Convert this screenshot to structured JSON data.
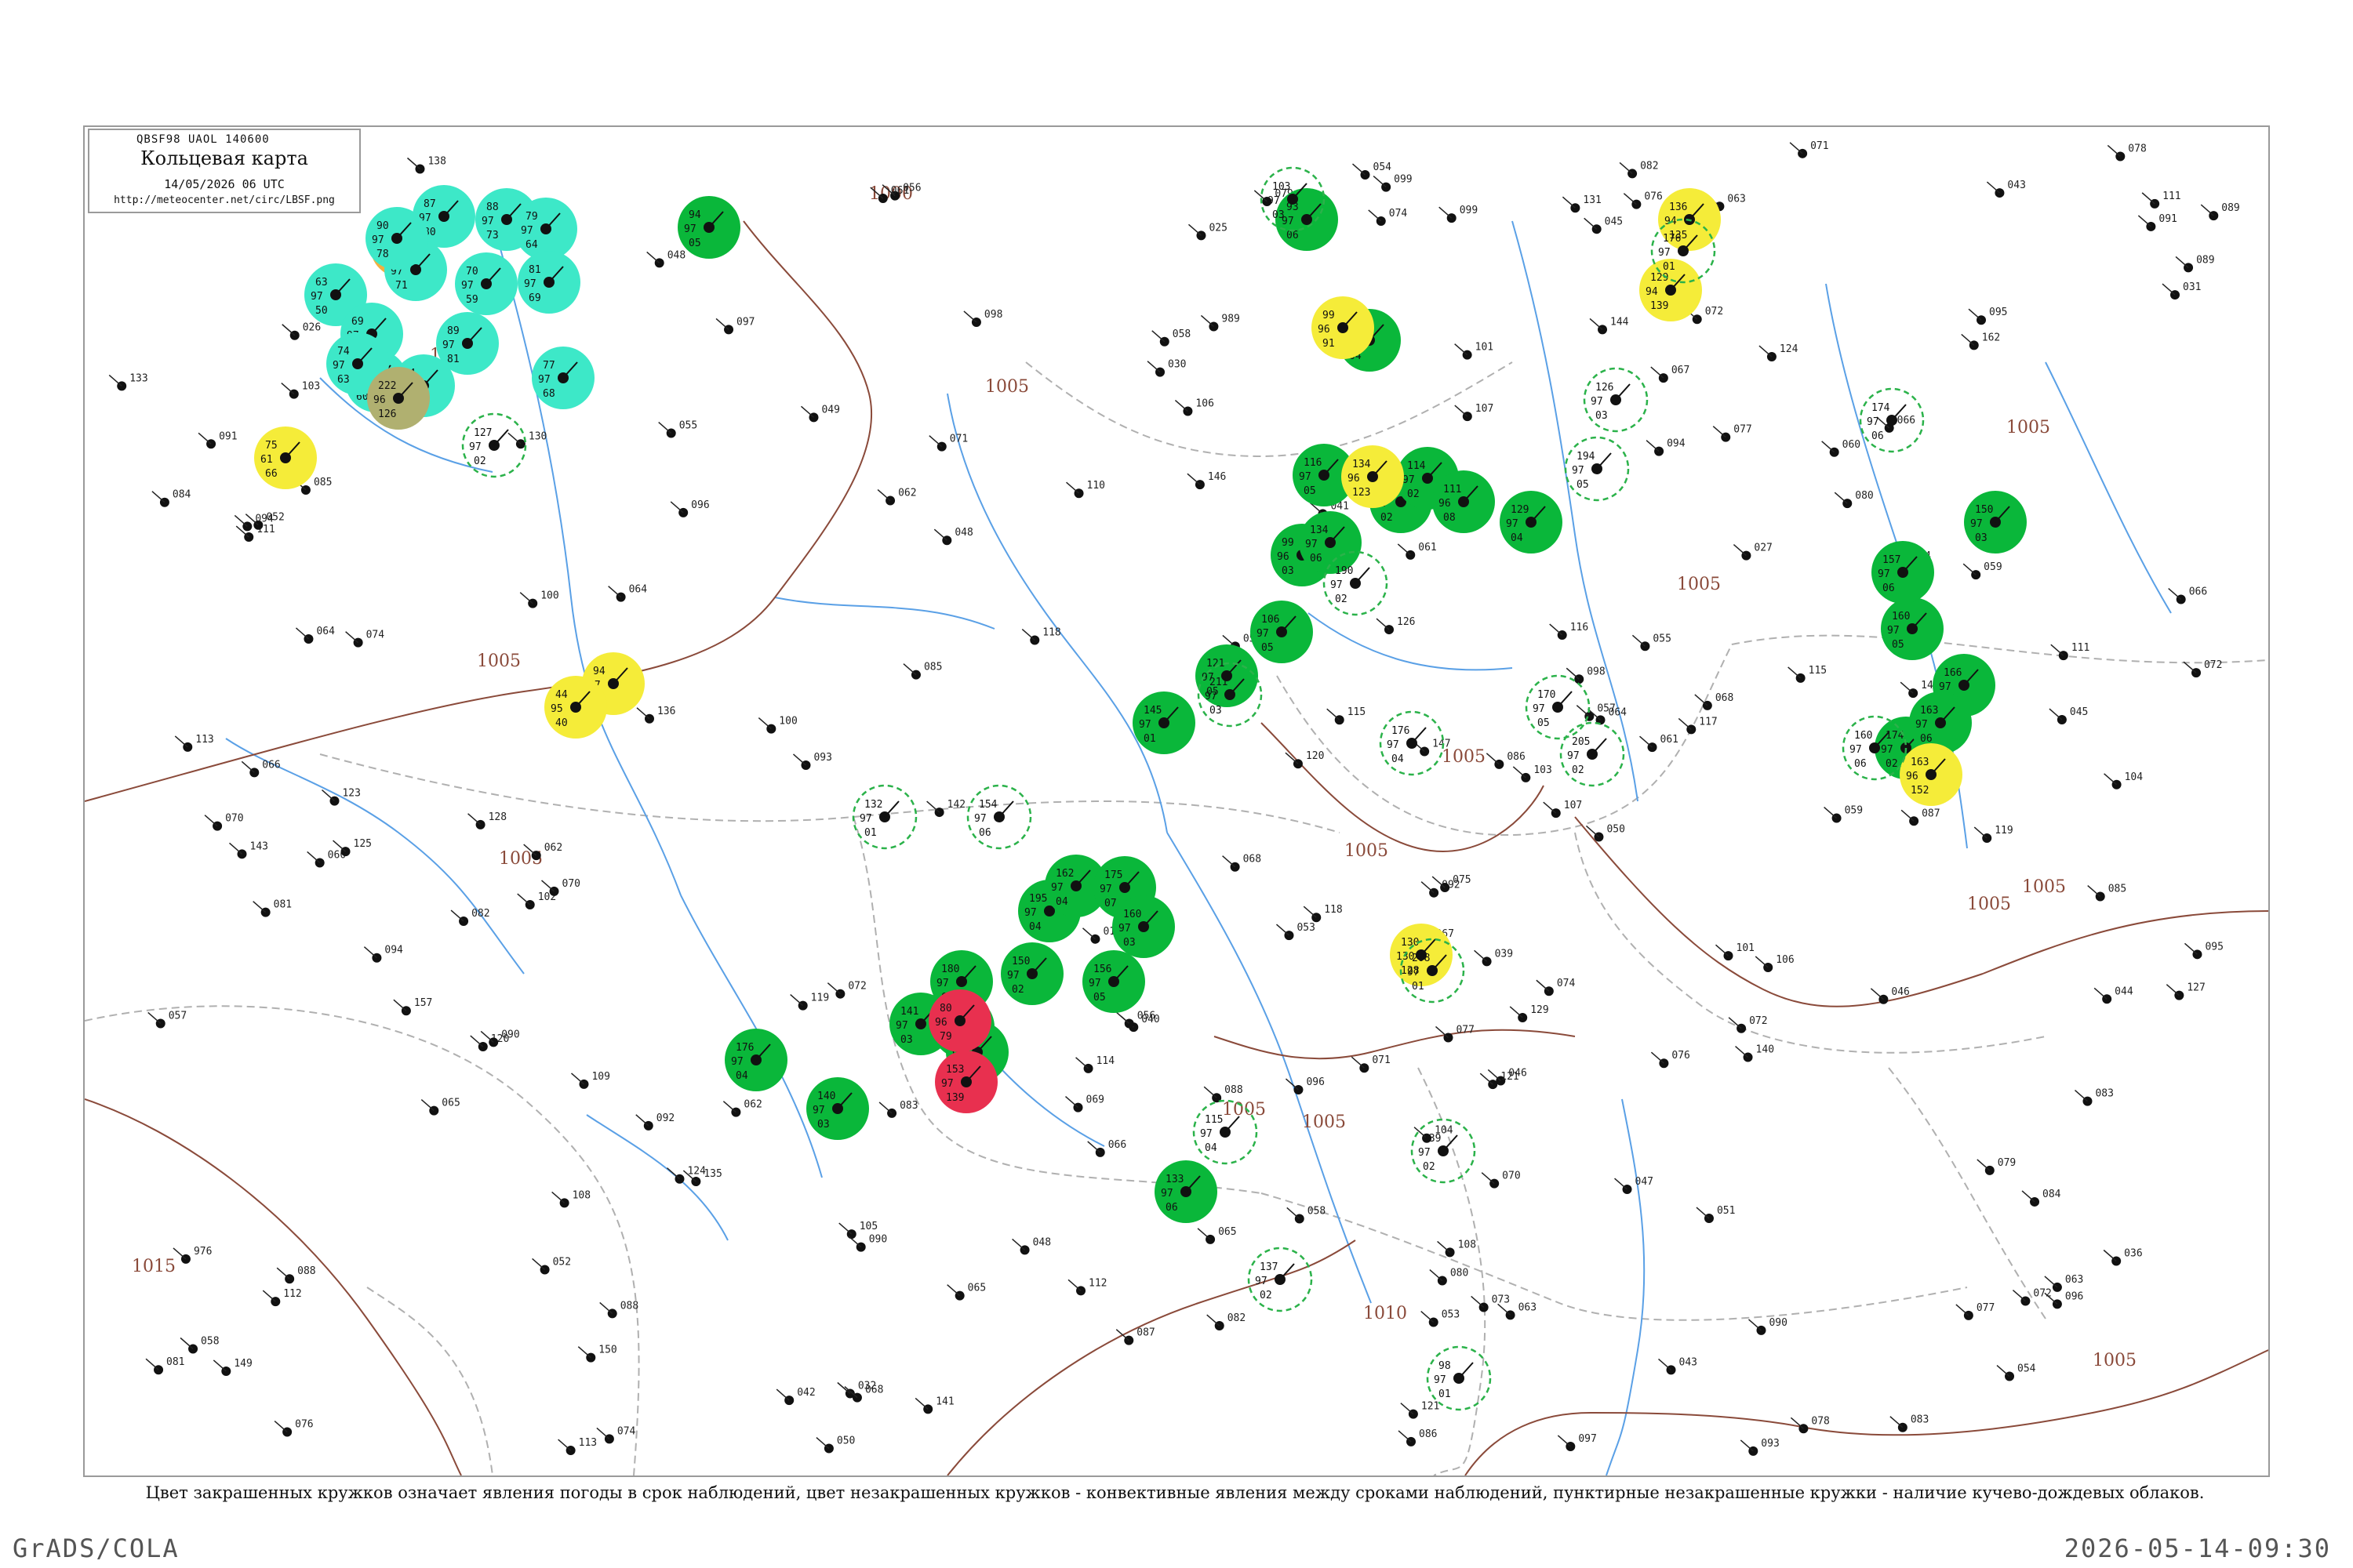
{
  "header": {
    "code": "QBSF98  UAOL  140600",
    "title": "Кольцевая карта",
    "time": "14/05/2026 06 UTC",
    "url": "http://meteocenter.net/circ/LBSF.png"
  },
  "footer": {
    "note": "Цвет закрашенных кружков означает явления погоды в срок наблюдений, цвет незакрашенных кружков - конвективные явления между сроками наблюдений, пунктирные незакрашенные кружки - наличие кучево-дождевых облаков.",
    "grads": "GrADS/COLA",
    "timestamp": "2026-05-14-09:30"
  },
  "colors": {
    "background": "#ffffff",
    "frame": "#9a9a9a",
    "isobar": "#8a4a3a",
    "river": "#5aa0e6",
    "border": "#b0b0b0",
    "rain": "#0ab73a",
    "shower": "#f5ec39",
    "thunder": "#e8304f",
    "fog": "#3de8c8",
    "dust": "#b0b070",
    "haze": "#f0b040",
    "outline": "#2bb24a"
  },
  "isobar_labels": [
    "1000",
    "1005",
    "1005",
    "1005",
    "1005",
    "1005",
    "1005",
    "1005",
    "1005",
    "1005",
    "1005",
    "1005",
    "1010",
    "1015",
    "1005",
    "1005"
  ],
  "stations": [
    {
      "type": "fill",
      "color": "rain",
      "v": [
        "94",
        "97",
        "05"
      ]
    },
    {
      "type": "fill",
      "color": "rain",
      "v": [
        "93",
        "97",
        "06"
      ]
    },
    {
      "type": "fill",
      "color": "rain",
      "v": [
        "88",
        "97",
        "04"
      ]
    },
    {
      "type": "fill",
      "color": "rain",
      "v": [
        "99",
        "96",
        "03"
      ]
    },
    {
      "type": "fill",
      "color": "rain",
      "v": [
        "134",
        "97",
        "06"
      ]
    },
    {
      "type": "fill",
      "color": "rain",
      "v": [
        "116",
        "97",
        "05"
      ]
    },
    {
      "type": "fill",
      "color": "rain",
      "v": [
        "112",
        "97",
        "02"
      ]
    },
    {
      "type": "fill",
      "color": "rain",
      "v": [
        "114",
        "97",
        "02"
      ]
    },
    {
      "type": "fill",
      "color": "rain",
      "v": [
        "111",
        "96",
        "08"
      ]
    },
    {
      "type": "fill",
      "color": "rain",
      "v": [
        "129",
        "97",
        "04"
      ]
    },
    {
      "type": "fill",
      "color": "rain",
      "v": [
        "106",
        "97",
        "05"
      ]
    },
    {
      "type": "fill",
      "color": "rain",
      "v": [
        "121",
        "97",
        "05"
      ]
    },
    {
      "type": "fill",
      "color": "rain",
      "v": [
        "145",
        "97",
        "01"
      ]
    },
    {
      "type": "fill",
      "color": "rain",
      "v": [
        "195",
        "97",
        "04"
      ]
    },
    {
      "type": "fill",
      "color": "rain",
      "v": [
        "162",
        "97",
        "04"
      ]
    },
    {
      "type": "fill",
      "color": "rain",
      "v": [
        "175",
        "97",
        "07"
      ]
    },
    {
      "type": "fill",
      "color": "rain",
      "v": [
        "160",
        "97",
        "03"
      ]
    },
    {
      "type": "fill",
      "color": "rain",
      "v": [
        "150",
        "97",
        "02"
      ]
    },
    {
      "type": "fill",
      "color": "rain",
      "v": [
        "156",
        "97",
        "05"
      ]
    },
    {
      "type": "fill",
      "color": "rain",
      "v": [
        "141",
        "97",
        "03"
      ]
    },
    {
      "type": "fill",
      "color": "rain",
      "v": [
        "153",
        "97",
        "02"
      ]
    },
    {
      "type": "fill",
      "color": "rain",
      "v": [
        "180",
        "97",
        "06"
      ]
    },
    {
      "type": "fill",
      "color": "rain",
      "v": [
        "196",
        "97",
        "01"
      ]
    },
    {
      "type": "fill",
      "color": "rain",
      "v": [
        "176",
        "97",
        "04"
      ]
    },
    {
      "type": "fill",
      "color": "rain",
      "v": [
        "140",
        "97",
        "03"
      ]
    },
    {
      "type": "fill",
      "color": "rain",
      "v": [
        "133",
        "97",
        "06"
      ]
    },
    {
      "type": "fill",
      "color": "rain",
      "v": [
        "160",
        "97",
        "05"
      ]
    },
    {
      "type": "fill",
      "color": "rain",
      "v": [
        "157",
        "97",
        "06"
      ]
    },
    {
      "type": "fill",
      "color": "rain",
      "v": [
        "150",
        "97",
        "03"
      ]
    },
    {
      "type": "fill",
      "color": "rain",
      "v": [
        "174",
        "97",
        "02"
      ]
    },
    {
      "type": "fill",
      "color": "rain",
      "v": [
        "166",
        "97",
        "04"
      ]
    },
    {
      "type": "fill",
      "color": "rain",
      "v": [
        "163",
        "97",
        "06"
      ]
    },
    {
      "type": "fill",
      "color": "shower",
      "v": [
        "75",
        "61",
        "66"
      ]
    },
    {
      "type": "fill",
      "color": "shower",
      "v": [
        "94",
        "97",
        "03"
      ]
    },
    {
      "type": "fill",
      "color": "shower",
      "v": [
        "44",
        "95",
        "40"
      ]
    },
    {
      "type": "fill",
      "color": "shower",
      "v": [
        "99",
        "96",
        "91"
      ]
    },
    {
      "type": "fill",
      "color": "shower",
      "v": [
        "134",
        "96",
        "123"
      ]
    },
    {
      "type": "fill",
      "color": "shower",
      "v": [
        "136",
        "94",
        "135"
      ]
    },
    {
      "type": "fill",
      "color": "shower",
      "v": [
        "129",
        "94",
        "139"
      ]
    },
    {
      "type": "fill",
      "color": "shower",
      "v": [
        "163",
        "96",
        "152"
      ]
    },
    {
      "type": "fill",
      "color": "shower",
      "v": [
        "130",
        "130",
        "128"
      ]
    },
    {
      "type": "fill",
      "color": "thunder",
      "v": [
        "80",
        "96",
        "79"
      ]
    },
    {
      "type": "fill",
      "color": "thunder",
      "v": [
        "153",
        "97",
        "139"
      ]
    },
    {
      "type": "fill",
      "color": "haze",
      "v": [
        "88",
        "96",
        "86"
      ]
    },
    {
      "type": "fill",
      "color": "fog",
      "v": [
        "63",
        "97",
        "50"
      ]
    },
    {
      "type": "fill",
      "color": "fog",
      "v": [
        "76",
        "97",
        "60"
      ]
    },
    {
      "type": "fill",
      "color": "fog",
      "v": [
        "87",
        "97",
        "80"
      ]
    },
    {
      "type": "fill",
      "color": "fog",
      "v": [
        "77",
        "97",
        "68"
      ]
    },
    {
      "type": "fill",
      "color": "fog",
      "v": [
        "84",
        "97",
        "74"
      ]
    },
    {
      "type": "fill",
      "color": "fog",
      "v": [
        "89",
        "97",
        "81"
      ]
    },
    {
      "type": "fill",
      "color": "fog",
      "v": [
        "70",
        "97",
        "59"
      ]
    },
    {
      "type": "fill",
      "color": "fog",
      "v": [
        "82",
        "97",
        "71"
      ]
    },
    {
      "type": "fill",
      "color": "fog",
      "v": [
        "90",
        "97",
        "78"
      ]
    },
    {
      "type": "fill",
      "color": "fog",
      "v": [
        "88",
        "97",
        "73"
      ]
    },
    {
      "type": "fill",
      "color": "fog",
      "v": [
        "79",
        "97",
        "64"
      ]
    },
    {
      "type": "fill",
      "color": "fog",
      "v": [
        "81",
        "97",
        "69"
      ]
    },
    {
      "type": "fill",
      "color": "fog",
      "v": [
        "69",
        "97",
        "58"
      ]
    },
    {
      "type": "fill",
      "color": "fog",
      "v": [
        "74",
        "97",
        "63"
      ]
    },
    {
      "type": "fill",
      "color": "dust",
      "v": [
        "222",
        "96",
        "126"
      ]
    },
    {
      "type": "ring",
      "v": [
        "98",
        "97",
        "01"
      ]
    },
    {
      "type": "ring",
      "v": [
        "127",
        "97",
        "02"
      ]
    },
    {
      "type": "ring",
      "v": [
        "103",
        "97",
        "03"
      ]
    },
    {
      "type": "ring",
      "v": [
        "132",
        "97",
        "01"
      ]
    },
    {
      "type": "ring",
      "v": [
        "154",
        "97",
        "06"
      ]
    },
    {
      "type": "ring",
      "v": [
        "208",
        "97",
        "01"
      ]
    },
    {
      "type": "ring",
      "v": [
        "137",
        "97",
        "02"
      ]
    },
    {
      "type": "ring",
      "v": [
        "115",
        "97",
        "04"
      ]
    },
    {
      "type": "ring",
      "v": [
        "211",
        "97",
        "03"
      ]
    },
    {
      "type": "ring",
      "v": [
        "139",
        "97",
        "02"
      ]
    },
    {
      "type": "ring",
      "v": [
        "176",
        "97",
        "04"
      ]
    },
    {
      "type": "ring",
      "v": [
        "170",
        "97",
        "05"
      ]
    },
    {
      "type": "ring",
      "v": [
        "205",
        "97",
        "02"
      ]
    },
    {
      "type": "ring",
      "v": [
        "160",
        "97",
        "06"
      ]
    },
    {
      "type": "ring",
      "v": [
        "190",
        "97",
        "02"
      ]
    },
    {
      "type": "ring",
      "v": [
        "194",
        "97",
        "05"
      ]
    },
    {
      "type": "ring",
      "v": [
        "126",
        "97",
        "03"
      ]
    },
    {
      "type": "ring",
      "v": [
        "174",
        "97",
        "06"
      ]
    },
    {
      "type": "ring",
      "v": [
        "176",
        "97",
        "01"
      ]
    }
  ],
  "plain_stations": [
    "976",
    "989",
    "015",
    "025",
    "043",
    "048",
    "094",
    "061",
    "072",
    "066",
    "053",
    "083",
    "071",
    "084",
    "092",
    "103",
    "111",
    "076",
    "081",
    "072",
    "097",
    "078",
    "085",
    "063",
    "058",
    "045",
    "065",
    "101",
    "042",
    "036",
    "077",
    "054",
    "032",
    "047",
    "066",
    "058",
    "123",
    "046",
    "098",
    "115",
    "072",
    "062",
    "088",
    "093",
    "057",
    "031",
    "070",
    "084",
    "108",
    "120",
    "064",
    "052",
    "111",
    "133",
    "074",
    "107",
    "095",
    "089",
    "041",
    "026",
    "119",
    "082",
    "066",
    "147",
    "090",
    "055",
    "118",
    "064",
    "035",
    "048",
    "073",
    "061",
    "102",
    "069",
    "124",
    "078",
    "030",
    "083",
    "141",
    "105",
    "060",
    "076",
    "050",
    "027",
    "097",
    "056",
    "072",
    "085",
    "113",
    "068",
    "049",
    "094",
    "080",
    "065",
    "090",
    "104",
    "096",
    "058",
    "117",
    "062",
    "091",
    "040",
    "074",
    "109",
    "063",
    "087",
    "052",
    "079",
    "145",
    "121",
    "086",
    "104",
    "067",
    "092",
    "100",
    "070",
    "059",
    "096",
    "081",
    "057",
    "112",
    "071",
    "099",
    "136",
    "054",
    "088",
    "106",
    "075",
    "110",
    "146",
    "068",
    "127",
    "138",
    "044",
    "093",
    "125",
    "083",
    "069",
    "116",
    "039",
    "086",
    "082",
    "113",
    "050",
    "162",
    "149",
    "046",
    "131",
    "065",
    "101",
    "077",
    "118",
    "061",
    "043",
    "089",
    "094",
    "157",
    "074",
    "121",
    "055",
    "143",
    "103",
    "085",
    "066",
    "130",
    "072",
    "124",
    "135",
    "087",
    "112",
    "058",
    "099",
    "140",
    "060",
    "076",
    "108",
    "128",
    "051",
    "095",
    "071",
    "115",
    "063",
    "082",
    "144",
    "048",
    "090",
    "119",
    "067",
    "079",
    "122",
    "064",
    "098",
    "111",
    "150",
    "053",
    "129",
    "077",
    "088",
    "106",
    "084",
    "070",
    "091",
    "114",
    "062",
    "068",
    "107",
    "142",
    "045",
    "096",
    "056",
    "126",
    "080",
    "120",
    "074",
    "100",
    "059"
  ]
}
